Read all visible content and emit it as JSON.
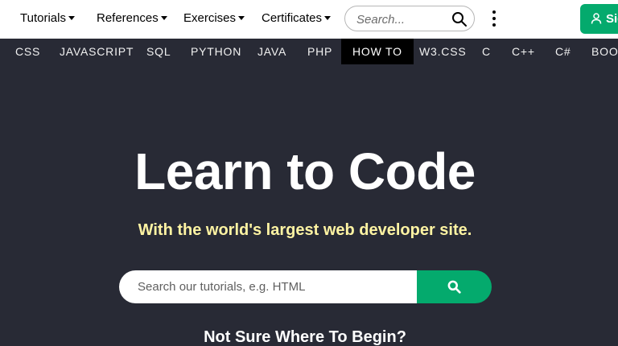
{
  "topbar": {
    "menu": [
      {
        "label": "Tutorials"
      },
      {
        "label": "References"
      },
      {
        "label": "Exercises"
      },
      {
        "label": "Certificates"
      }
    ],
    "search_placeholder": "Search...",
    "signin_label": "Sig"
  },
  "subnav": {
    "items": [
      "CSS",
      "JAVASCRIPT",
      "SQL",
      "PYTHON",
      "JAVA",
      "PHP",
      "HOW TO",
      "W3.CSS",
      "C",
      "C++",
      "C#",
      "BOOT"
    ],
    "active": "HOW TO"
  },
  "hero": {
    "title": "Learn to Code",
    "subtitle": "With the world's largest web developer site.",
    "search_placeholder": "Search our tutorials, e.g. HTML",
    "begin_text": "Not Sure Where To Begin?"
  },
  "colors": {
    "brand_green": "#04AA6D",
    "dark_bg": "#282A35",
    "subtitle_yellow": "#FFF4A3"
  },
  "icons": [
    "caret-down-icon",
    "search-icon",
    "kebab-menu-icon",
    "user-icon"
  ]
}
